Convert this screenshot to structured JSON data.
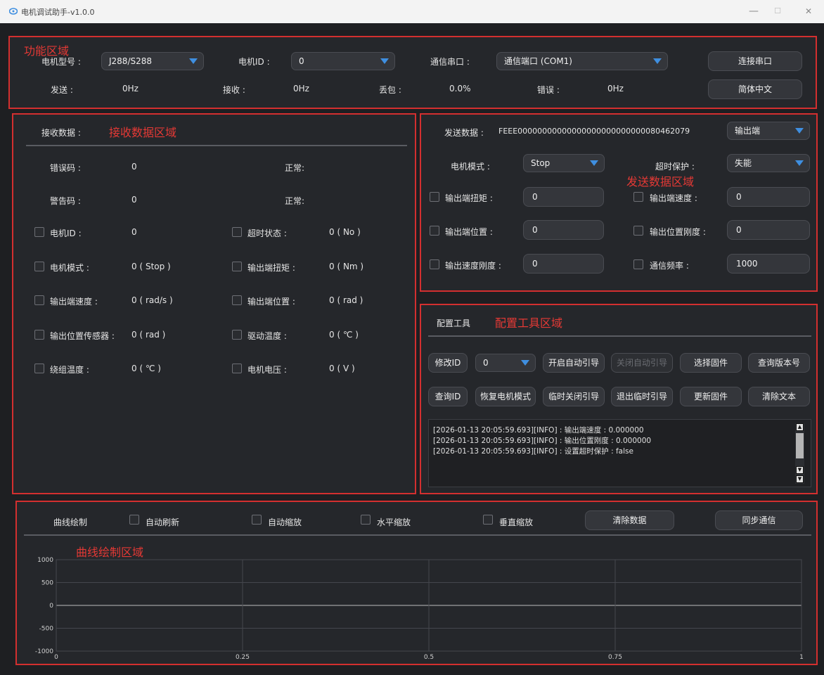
{
  "window": {
    "title": "电机调试助手-v1.0.0",
    "minimize": "—",
    "maximize": "☐",
    "close": "✕"
  },
  "zones": {
    "func": "功能区域",
    "recv": "接收数据区域",
    "send": "发送数据区域",
    "config": "配置工具区域",
    "curve": "曲线绘制区域"
  },
  "func": {
    "motor_model_label": "电机型号 :",
    "motor_model_value": "J288/S288",
    "motor_id_label": "电机ID :",
    "motor_id_value": "0",
    "serial_label": "通信串口 :",
    "serial_value": "通信端口 (COM1)",
    "connect_button": "连接串口",
    "send_label": "发送 :",
    "send_value": "0Hz",
    "recv_label": "接收 :",
    "recv_value": "0Hz",
    "loss_label": "丢包 :",
    "loss_value": "0.0%",
    "error_label": "错误 :",
    "error_value": "0Hz",
    "language_button": "简体中文"
  },
  "recv": {
    "header": "接收数据 :",
    "error_code_label": "错误码 :",
    "error_code_value": "0",
    "error_code_status": "正常:",
    "warn_code_label": "警告码 :",
    "warn_code_value": "0",
    "warn_code_status": "正常:",
    "items_left": [
      {
        "label": "电机ID :",
        "value": "0"
      },
      {
        "label": "电机模式 :",
        "value": "0 ( Stop )"
      },
      {
        "label": "输出端速度 :",
        "value": "0 ( rad/s )"
      },
      {
        "label": "输出位置传感器 :",
        "value": "0 ( rad )"
      },
      {
        "label": "绕组温度 :",
        "value": "0 ( ℃ )"
      }
    ],
    "items_right": [
      {
        "label": "超时状态 :",
        "value": "0 ( No )"
      },
      {
        "label": "输出端扭矩 :",
        "value": "0 ( Nm )"
      },
      {
        "label": "输出端位置 :",
        "value": "0 ( rad )"
      },
      {
        "label": "驱动温度 :",
        "value": "0 ( ℃ )"
      },
      {
        "label": "电机电压 :",
        "value": "0 ( V )"
      }
    ]
  },
  "send": {
    "header": "发送数据 :",
    "hex": "FEEE00000000000000000000000000080462079",
    "target_value": "输出端",
    "mode_label": "电机模式 :",
    "mode_value": "Stop",
    "timeout_label": "超时保护 :",
    "timeout_value": "失能",
    "fields_left": [
      {
        "label": "输出端扭矩 :",
        "value": "0"
      },
      {
        "label": "输出端位置 :",
        "value": "0"
      },
      {
        "label": "输出速度刚度 :",
        "value": "0"
      }
    ],
    "fields_right": [
      {
        "label": "输出端速度 :",
        "value": "0"
      },
      {
        "label": "输出位置刚度 :",
        "value": "0"
      },
      {
        "label": "通信频率 :",
        "value": "1000"
      }
    ]
  },
  "config": {
    "tab": "配置工具",
    "row1": {
      "modify_id": "修改ID",
      "id_value": "0",
      "start_guide": "开启自动引导",
      "stop_guide": "关闭自动引导",
      "select_fw": "选择固件",
      "query_ver": "查询版本号"
    },
    "row2": {
      "query_id": "查询ID",
      "restore_mode": "恢复电机模式",
      "temp_close": "临时关闭引导",
      "exit_temp": "退出临时引导",
      "update_fw": "更新固件",
      "clear_text": "清除文本"
    },
    "log": [
      "[2026-01-13 20:05:59.693][INFO] : 输出端速度 : 0.000000",
      "[2026-01-13 20:05:59.693][INFO] : 输出位置刚度 : 0.000000",
      "[2026-01-13 20:05:59.693][INFO] : 设置超时保护 : false"
    ]
  },
  "curve": {
    "title": "曲线绘制",
    "auto_refresh": "自动刷新",
    "auto_zoom": "自动缩放",
    "h_zoom": "水平缩放",
    "v_zoom": "垂直缩放",
    "clear_button": "清除数据",
    "sync_button": "同步通信"
  },
  "chart_data": {
    "type": "line",
    "xlim": [
      0,
      1
    ],
    "ylim": [
      -1000,
      1000
    ],
    "x_ticks": [
      "0",
      "0.25",
      "0.5",
      "0.75",
      "1"
    ],
    "y_ticks": [
      "1000",
      "500",
      "0",
      "-500",
      "-1000"
    ],
    "series": [],
    "grid": true
  },
  "colors": {
    "accent": "#3f8fe0",
    "zone_border": "#d32f2f",
    "background": "#1e1f22"
  }
}
